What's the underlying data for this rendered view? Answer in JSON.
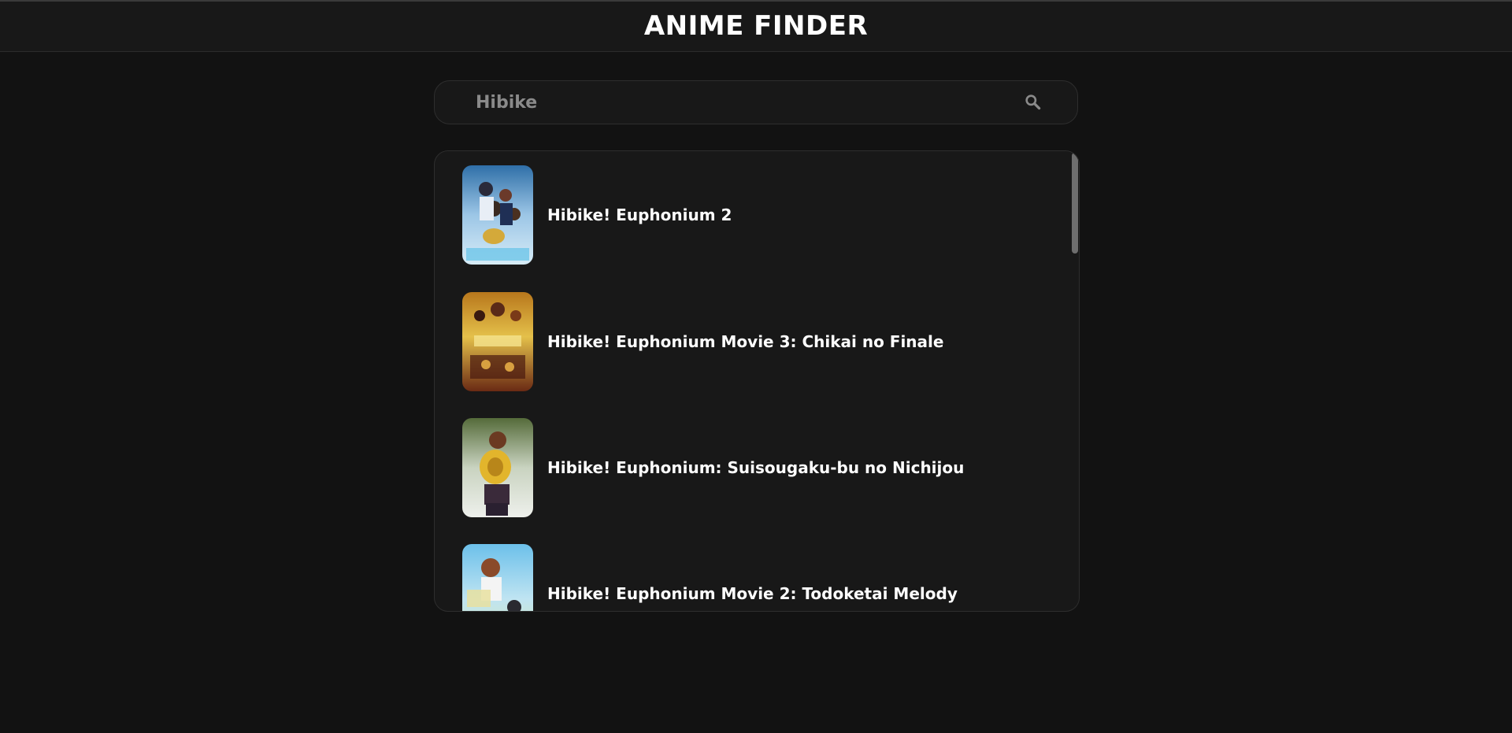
{
  "header": {
    "title": "ANIME FINDER"
  },
  "search": {
    "value": "Hibike",
    "icon": "search-icon"
  },
  "results": [
    {
      "title": "Hibike! Euphonium 2",
      "poster": "poster-blue-group"
    },
    {
      "title": "Hibike! Euphonium Movie 3: Chikai no Finale",
      "poster": "poster-gold-orchestra"
    },
    {
      "title": "Hibike! Euphonium: Suisougaku-bu no Nichijou",
      "poster": "poster-euphonium-player"
    },
    {
      "title": "Hibike! Euphonium Movie 2: Todoketai Melody",
      "poster": "poster-sky-meadow"
    }
  ],
  "colors": {
    "background": "#121212",
    "panel": "#181818",
    "border": "#2e2e2e",
    "text": "#ffffff",
    "muted": "#8a8a8a",
    "scrollbar": "#6e6e6e"
  }
}
